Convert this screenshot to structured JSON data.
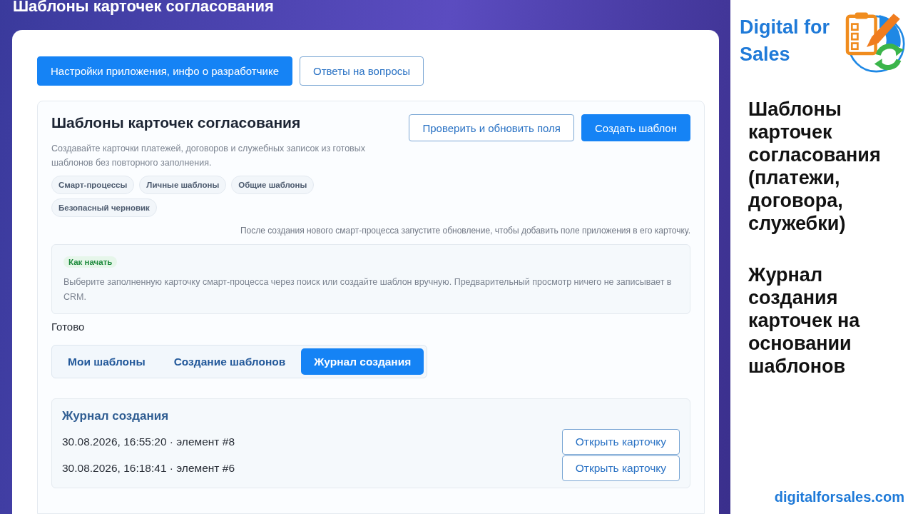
{
  "page_title": "Шаблоны карточек согласования",
  "top_buttons": [
    {
      "label": "Настройки приложения, инфо о разработчике",
      "primary": true
    },
    {
      "label": "Ответы на вопросы",
      "primary": false
    }
  ],
  "card": {
    "title": "Шаблоны карточек согласования",
    "description": "Создавайте карточки платежей, договоров и служебных записок из готовых шаблонов без повторного заполнения.",
    "actions": [
      {
        "label": "Проверить и обновить поля",
        "primary": false
      },
      {
        "label": "Создать шаблон",
        "primary": true
      }
    ],
    "tags": [
      "Смарт-процессы",
      "Личные шаблоны",
      "Общие шаблоны",
      "Безопасный черновик"
    ],
    "note": "После создания нового смарт-процесса запустите обновление, чтобы добавить поле приложения в его карточку.",
    "hint": {
      "badge": "Как начать",
      "text": "Выберите заполненную карточку смарт-процесса через поиск или создайте шаблон вручную. Предварительный просмотр ничего не записывает в CRM."
    },
    "status": "Готово",
    "tabs": [
      {
        "label": "Мои шаблоны",
        "selected": false
      },
      {
        "label": "Создание шаблонов",
        "selected": false
      },
      {
        "label": "Журнал создания",
        "selected": true
      }
    ],
    "log": {
      "title": "Журнал создания",
      "entries": [
        {
          "text": "30.08.2026, 16:55:20 · элемент #8",
          "button": "Открыть карточку"
        },
        {
          "text": "30.08.2026, 16:18:41 · элемент #6",
          "button": "Открыть карточку"
        }
      ]
    }
  },
  "promo": {
    "brand": "Digital for Sales",
    "paragraphs": [
      "Шаблоны карточек согласования (платежи, договора, служебки)",
      "Журнал создания карточек на основании шаблонов"
    ],
    "site": "digitalforsales.com"
  }
}
